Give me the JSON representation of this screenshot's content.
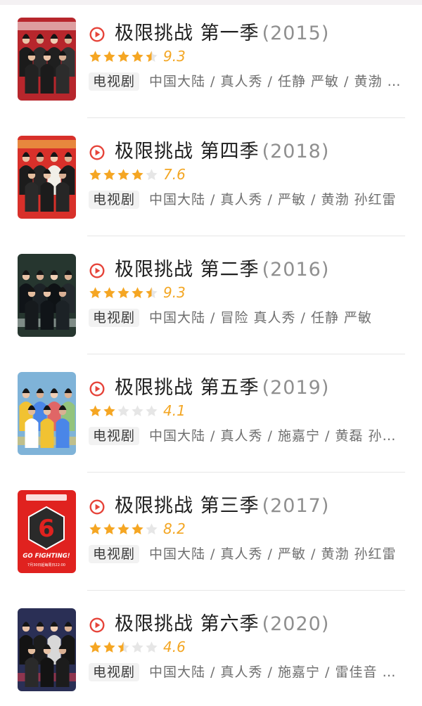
{
  "items": [
    {
      "title": "极限挑战 第一季",
      "year": "(2015)",
      "rating": 9.3,
      "rating_label": "9.3",
      "stars": 4.5,
      "tag": "电视剧",
      "meta": "中国大陆 / 真人秀 / 任静 严敏 / 黄渤 孙红雷",
      "poster": {
        "bg": "#b7262c",
        "accent": "#ffffff",
        "scene": "suits"
      }
    },
    {
      "title": "极限挑战 第四季",
      "year": "(2018)",
      "rating": 7.6,
      "rating_label": "7.6",
      "stars": 4,
      "tag": "电视剧",
      "meta": "中国大陆 / 真人秀 / 严敏 / 黄渤 孙红雷",
      "poster": {
        "bg": "#d8302a",
        "accent": "#f4d04c",
        "scene": "red"
      }
    },
    {
      "title": "极限挑战 第二季",
      "year": "(2016)",
      "rating": 9.3,
      "rating_label": "9.3",
      "stars": 4.5,
      "tag": "电视剧",
      "meta": "中国大陆 / 冒险 真人秀 / 任静 严敏",
      "poster": {
        "bg": "#26362f",
        "accent": "#c9d3cf",
        "scene": "dark"
      }
    },
    {
      "title": "极限挑战 第五季",
      "year": "(2019)",
      "rating": 4.1,
      "rating_label": "4.1",
      "stars": 2,
      "tag": "电视剧",
      "meta": "中国大陆 / 真人秀 / 施嘉宁 / 黄磊 孙红雷",
      "poster": {
        "bg": "#7fb3d8",
        "accent": "#f4c84f",
        "scene": "colorful"
      }
    },
    {
      "title": "极限挑战 第三季",
      "year": "(2017)",
      "rating": 8.2,
      "rating_label": "8.2",
      "stars": 4,
      "tag": "电视剧",
      "meta": "中国大陆 / 真人秀 / 严敏 / 黄渤 孙红雷",
      "poster": {
        "bg": "#e0221f",
        "accent": "#ffffff",
        "scene": "logo",
        "logo_text": "GO FIGHTING!",
        "caption": "7月30日起每周日22:00"
      }
    },
    {
      "title": "极限挑战 第六季",
      "year": "(2020)",
      "rating": 4.6,
      "rating_label": "4.6",
      "stars": 2.5,
      "tag": "电视剧",
      "meta": "中国大陆 / 真人秀 / 施嘉宁 / 雷佳音 黄渤",
      "poster": {
        "bg": "#2a2f55",
        "accent": "#e03a4a",
        "scene": "crowd"
      }
    }
  ],
  "colors": {
    "play": "#e6443a",
    "star_on": "#f5a623",
    "star_off": "#e6e6e6",
    "score": "#f3a623"
  }
}
